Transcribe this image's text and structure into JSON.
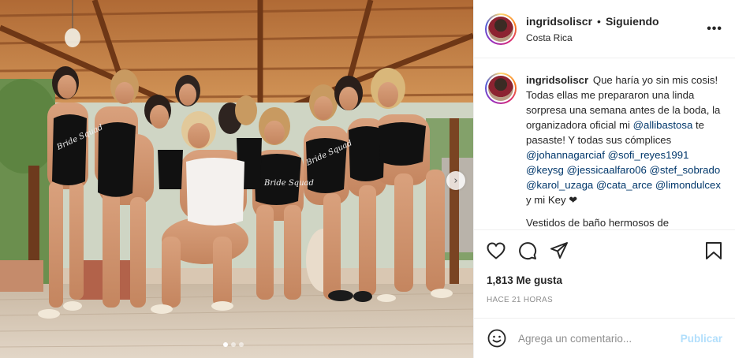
{
  "post": {
    "username": "ingridsoliscr",
    "separator": "•",
    "follow_status": "Siguiendo",
    "location": "Costa Rica",
    "more_icon": "more-horizontal-icon"
  },
  "caption": {
    "username": "ingridsoliscr",
    "text_1": "Que haría yo sin mis cosis! Todas ellas me prepararon una linda sorpresa una semana antes de la boda, la organizadora oficial mi",
    "mention_1": "@allibastosa",
    "text_2": "te pasaste! Y todas sus cómplices",
    "mentions": [
      "@johannagarciaf",
      "@sofi_reyes1991",
      "@keysg",
      "@jessicaalfaro06",
      "@stef_sobrado",
      "@karol_uzaga",
      "@cata_arce",
      "@limondulcex"
    ],
    "text_3": "y mi Key",
    "heart": "❤",
    "more_text": "Vestidos de baño hermosos de"
  },
  "photo": {
    "swimsuit_text": "Bride Squad",
    "next_icon": "chevron-right-icon",
    "carousel_count": 3,
    "carousel_active": 0
  },
  "actions": {
    "like_icon": "heart-icon",
    "comment_icon": "comment-icon",
    "share_icon": "paper-plane-icon",
    "save_icon": "bookmark-icon"
  },
  "likes": "1,813 Me gusta",
  "timestamp": "HACE 21 HORAS",
  "comment": {
    "placeholder": "Agrega un comentario...",
    "publish_label": "Publicar",
    "emoji_icon": "smiley-icon"
  },
  "colors": {
    "mention": "#00376b",
    "publish_disabled": "#b2dffc",
    "meta": "#8e8e8e",
    "text": "#262626"
  }
}
